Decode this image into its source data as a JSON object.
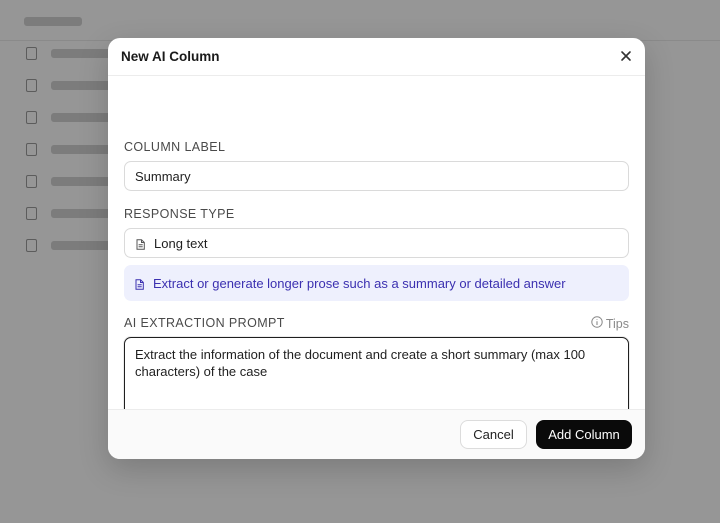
{
  "dialog": {
    "title": "New AI Column",
    "close_icon": "close-icon"
  },
  "column_label": {
    "label": "COLUMN LABEL",
    "value": "Summary"
  },
  "response_type": {
    "label": "RESPONSE TYPE",
    "selected": "Long text",
    "icon": "document-icon",
    "description": "Extract or generate longer prose such as a summary or detailed answer"
  },
  "prompt": {
    "label": "AI EXTRACTION PROMPT",
    "tips_label": "Tips",
    "tips_icon": "info-icon",
    "value": "Extract the information of the document and create a short summary (max 100 characters) of the case"
  },
  "footer": {
    "cancel_label": "Cancel",
    "add_label": "Add Column"
  },
  "colors": {
    "accent_text": "#3b30b0",
    "info_background": "#eef0fd",
    "primary_button": "#0a0a0a"
  }
}
